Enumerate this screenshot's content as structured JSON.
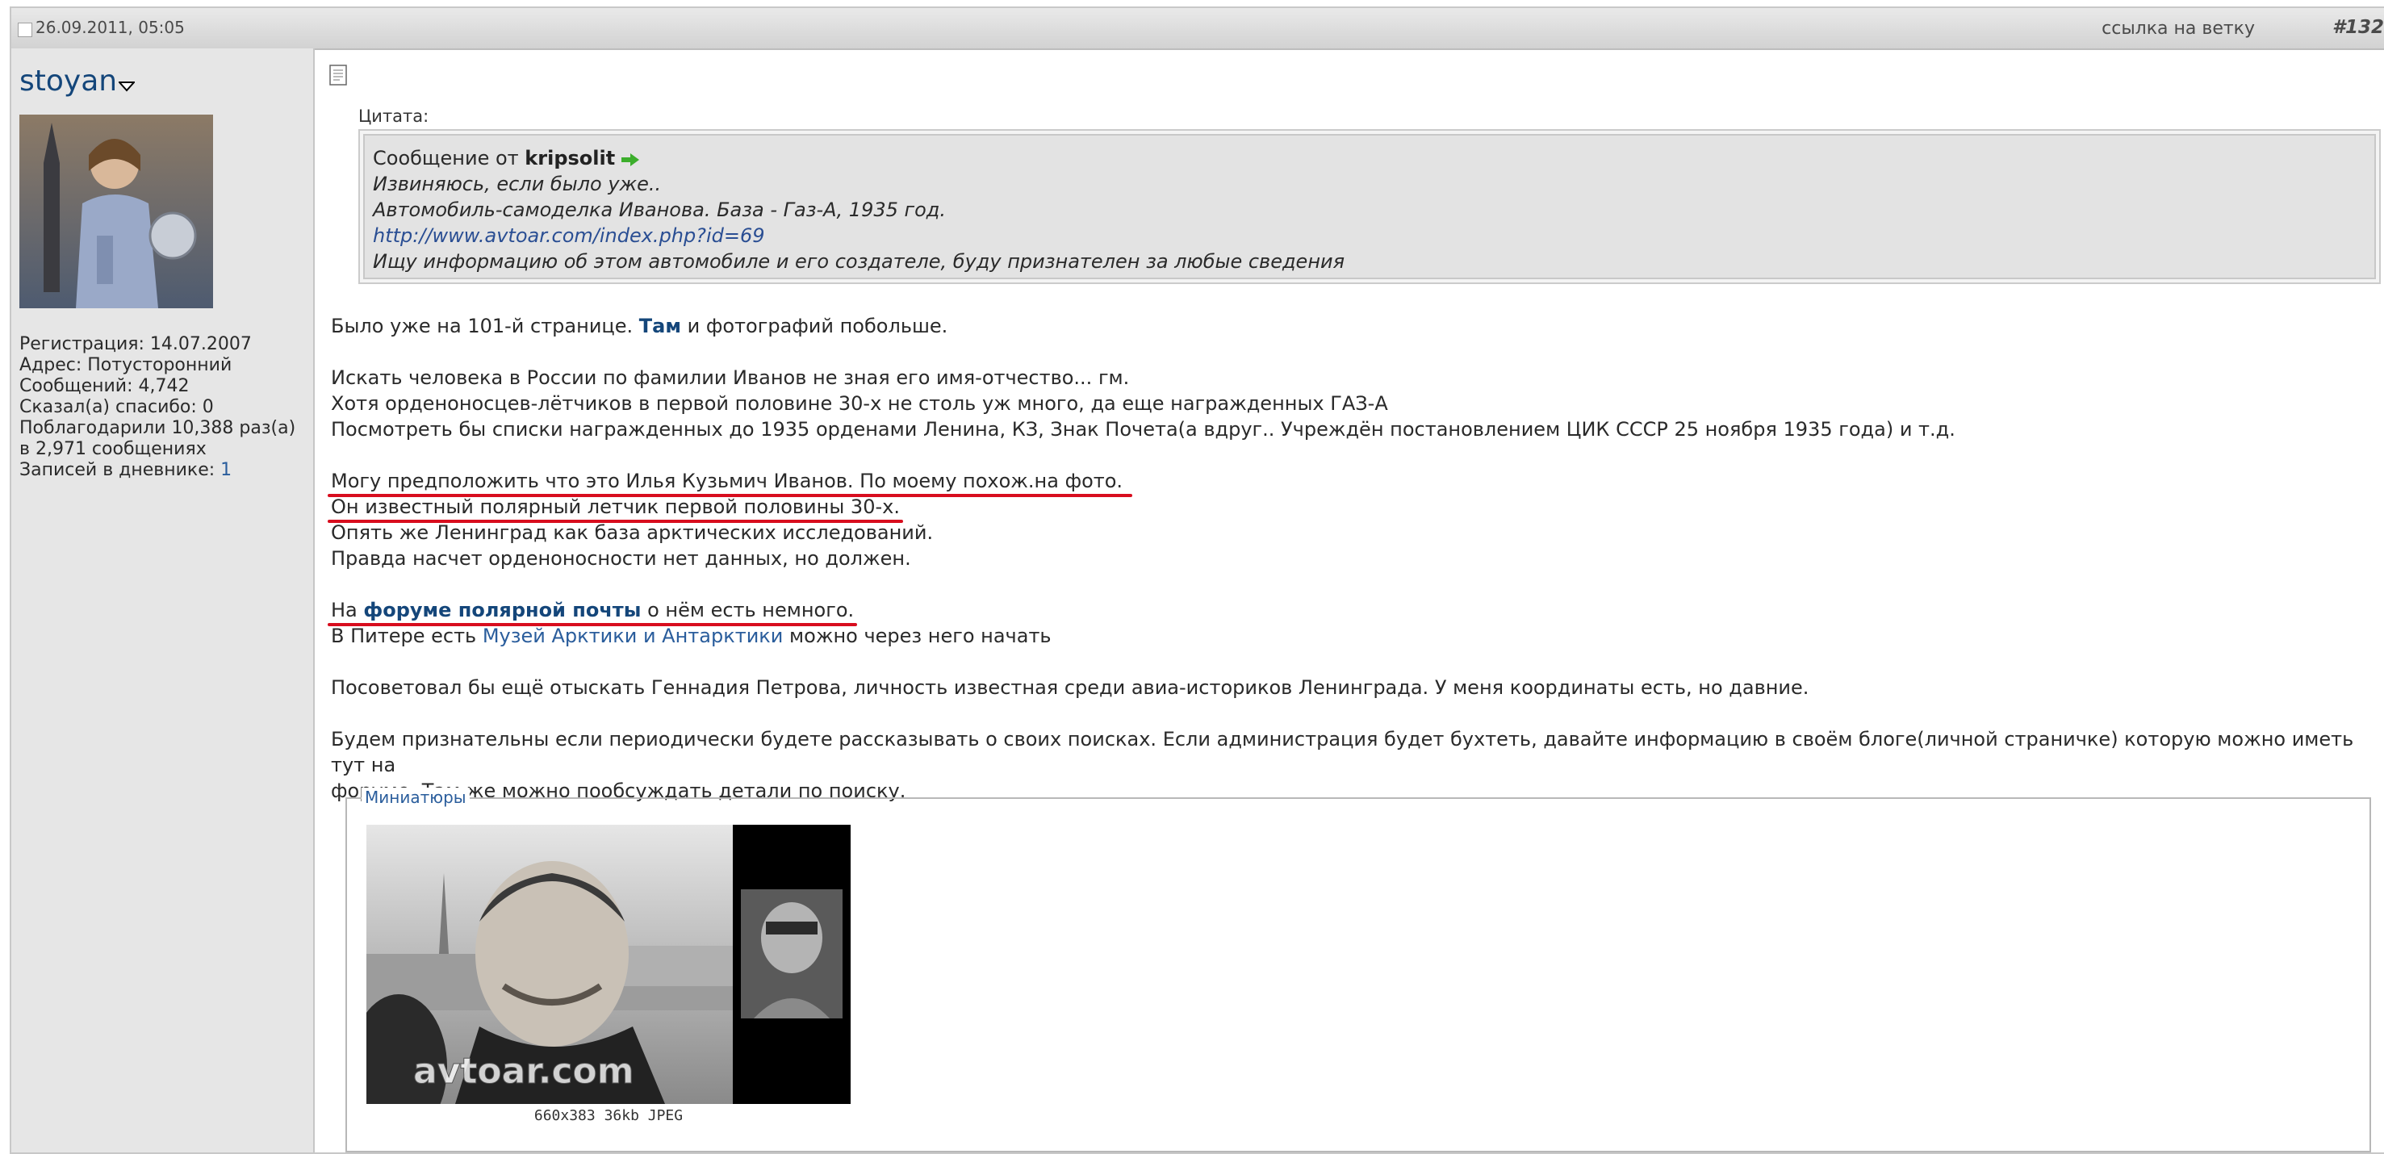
{
  "header": {
    "date": "26.09.2011, 05:05",
    "thread_link": "ссылка на ветку",
    "post_number": "#132"
  },
  "user": {
    "name": "stoyan",
    "stats": [
      "Регистрация: 14.07.2007",
      "Адрес: Потусторонний",
      "Сообщений: 4,742",
      "Сказал(а) спасибо: 0",
      "Поблагодарили 10,388 раз(а)",
      "в 2,971 сообщениях"
    ],
    "diary_label": "Записей в дневнике:",
    "diary_count": "1"
  },
  "quote": {
    "label": "Цитата:",
    "from": "Сообщение от",
    "author": "kripsolit",
    "lines": [
      "Извиняюсь, если было уже..",
      "Автомобиль-самоделка Иванова. База - Газ-А, 1935 год."
    ],
    "link": "http://www.avtoar.com/index.php?id=69",
    "last_line": "Ищу информацию об этом автомобиле и его создателе, буду признателен за любые сведения"
  },
  "body": {
    "p1_before": "Было уже на 101-й странице.",
    "p1_link": "Там",
    "p1_after": "и фотографий побольше.",
    "p2": [
      "Искать человека в России по фамилии Иванов не зная его имя-отчество... гм.",
      "Хотя орденоносцев-лётчиков в первой половине 30-х не столь уж много, да еще награжденных ГАЗ-А",
      "Посмотреть бы списки награжденных до 1935 орденами Ленина, КЗ, Знак Почета(а вдруг.. Учреждён постановлением ЦИК СССР 25 ноября 1935 года) и т.д."
    ],
    "p3_line1": "Могу предположить что это Илья Кузьмич Иванов. По моему похож.на фото.",
    "p3_line2": "Он известный полярный летчик первой половины 30-х.",
    "p3_line3": "Опять же Ленинград как база арктических исследований.",
    "p3_line4": "Правда насчет орденоносности нет данных, но должен.",
    "p4_before": "На",
    "p4_link": "форуме полярной почты",
    "p4_after": "о нём есть немного.",
    "p5_before": "В Питере есть",
    "p5_link": "Музей Арктики и Антарктики",
    "p5_after": "можно через него начать",
    "p6": "Посоветовал бы ещё отыскать Геннадия Петрова, личность известная среди авиа-историков Ленинграда. У меня координаты есть, но давние.",
    "p7": [
      "Будем признательны если периодически будете рассказывать о своих поисках. Если администрация будет бухтеть, давайте информацию в своём блоге(личной страничке) которую можно иметь тут на",
      "форуме. Там же можно пообсуждать детали по поиску."
    ]
  },
  "thumbnails": {
    "legend": "Миниатюры",
    "watermark": "avtoar.com",
    "caption": "660x383 36kb JPEG"
  },
  "colors": {
    "link_dark": "#14467a",
    "link": "#2a5d9c",
    "annotation_red": "#d80d1e"
  }
}
